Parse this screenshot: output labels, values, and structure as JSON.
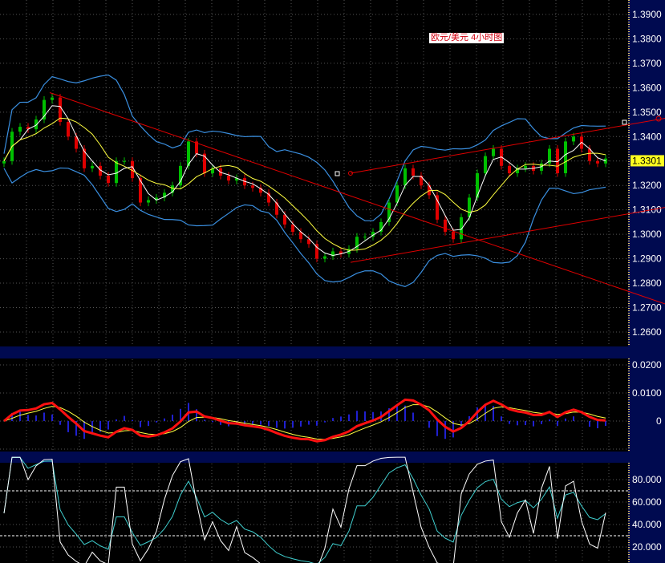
{
  "title": "欧元/美元 4小时图",
  "colors": {
    "bg": "#000000",
    "axis_bg": "#000a50",
    "band": "#000a50",
    "up": "#00c000",
    "down": "#e00000",
    "ma_fast": "#ffffff",
    "ma_slow": "#ffff40",
    "boll": "#3a8fe0",
    "trend": "#e00000",
    "macd": "#ff1010",
    "signal": "#ffff40",
    "hist": "#2020d0",
    "rsi_fast": "#ffffff",
    "rsi_slow": "#40d0d0"
  },
  "chart_data": [
    {
      "type": "candlestick",
      "name": "price",
      "title": "欧元/美元 4小时图",
      "ylim": [
        1.26,
        1.39
      ],
      "yticks": [
        "1.3900",
        "1.3800",
        "1.3700",
        "1.3600",
        "1.3500",
        "1.3400",
        "1.3300",
        "1.3200",
        "1.3100",
        "1.3000",
        "1.2900",
        "1.2800",
        "1.2700",
        "1.2600"
      ],
      "last_price": "1.3301",
      "closes": [
        1.33,
        1.342,
        1.344,
        1.343,
        1.347,
        1.355,
        1.356,
        1.346,
        1.34,
        1.335,
        1.327,
        1.328,
        1.324,
        1.321,
        1.33,
        1.33,
        1.323,
        1.313,
        1.314,
        1.315,
        1.317,
        1.32,
        1.328,
        1.338,
        1.333,
        1.325,
        1.327,
        1.324,
        1.322,
        1.323,
        1.32,
        1.319,
        1.317,
        1.313,
        1.308,
        1.304,
        1.301,
        1.298,
        1.296,
        1.29,
        1.291,
        1.293,
        1.292,
        1.294,
        1.299,
        1.299,
        1.301,
        1.305,
        1.313,
        1.32,
        1.327,
        1.324,
        1.32,
        1.316,
        1.306,
        1.301,
        1.298,
        1.307,
        1.315,
        1.325,
        1.332,
        1.335,
        1.328,
        1.325,
        1.327,
        1.328,
        1.326,
        1.329,
        1.335,
        1.325,
        1.338,
        1.34,
        1.335,
        1.33,
        1.329,
        1.331
      ],
      "overlays": [
        "MA fast",
        "MA slow",
        "Bollinger Bands"
      ],
      "trendlines": [
        {
          "name": "downtrend",
          "from": [
            5.7,
            1.358
          ],
          "to": [
            82.4,
            1.2715
          ]
        },
        {
          "name": "channel-upper",
          "from": [
            43.2,
            1.325
          ],
          "to": [
            82.4,
            1.3475
          ]
        },
        {
          "name": "channel-lower",
          "from": [
            43.2,
            1.2885
          ],
          "to": [
            82.4,
            1.311
          ]
        }
      ]
    },
    {
      "type": "line",
      "name": "MACD",
      "ylim": [
        -0.011,
        0.0225
      ],
      "yticks": [
        "0.0200",
        "0.0100",
        "0"
      ],
      "series": [
        "MACD",
        "Signal",
        "Histogram"
      ]
    },
    {
      "type": "line",
      "name": "RSI",
      "ylim": [
        0,
        100
      ],
      "yticks": [
        "80.000",
        "60.000",
        "40.000",
        "20.000"
      ],
      "levels": [
        70,
        30
      ],
      "series": [
        "RSI fast",
        "RSI slow"
      ]
    }
  ]
}
